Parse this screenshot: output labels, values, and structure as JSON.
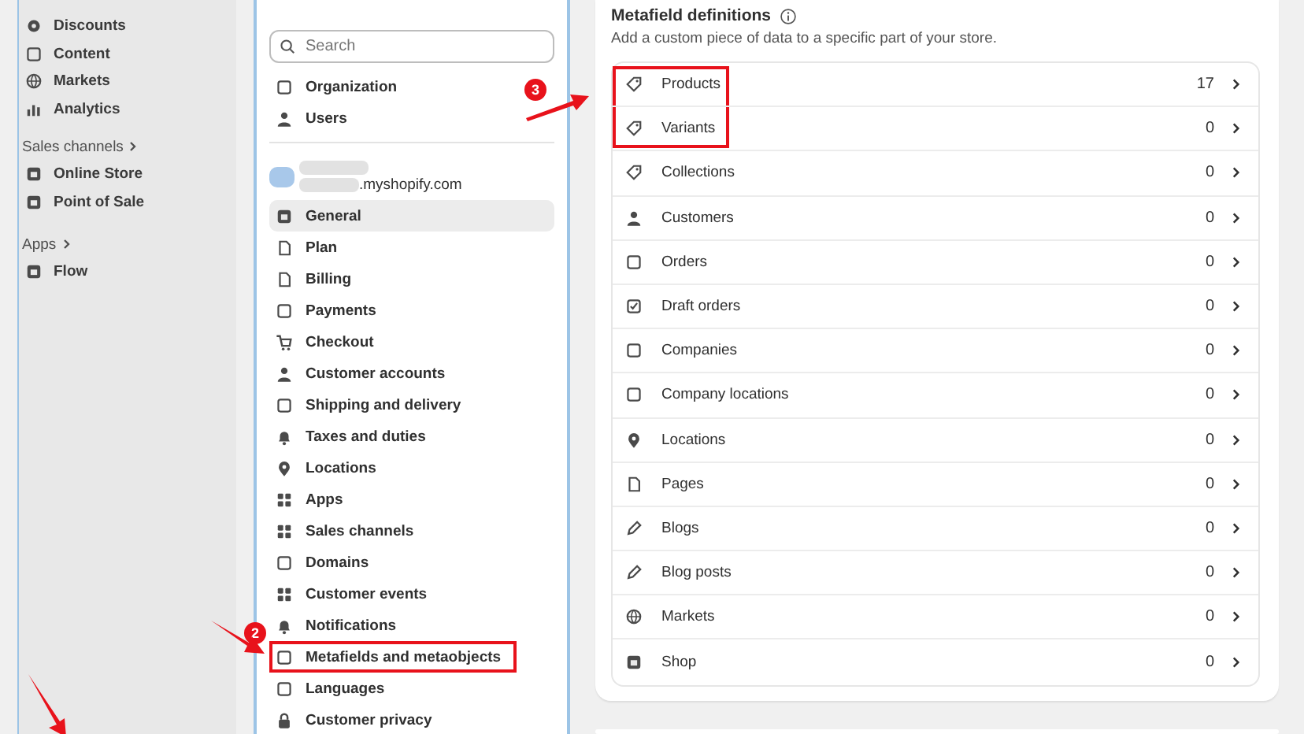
{
  "main_nav": {
    "items": [
      {
        "label": "Discounts"
      },
      {
        "label": "Content"
      },
      {
        "label": "Markets"
      },
      {
        "label": "Analytics"
      }
    ],
    "sections": [
      {
        "heading": "Sales channels",
        "items": [
          {
            "label": "Online Store"
          },
          {
            "label": "Point of Sale"
          }
        ]
      },
      {
        "heading": "Apps",
        "items": [
          {
            "label": "Flow"
          }
        ]
      }
    ]
  },
  "settings_nav": {
    "search": {
      "placeholder": "Search"
    },
    "top_items": [
      {
        "label": "Organization"
      },
      {
        "label": "Users"
      }
    ],
    "store": {
      "domain": ".myshopify.com"
    },
    "items": [
      {
        "label": "General",
        "selected": true,
        "highlighted": false
      },
      {
        "label": "Plan",
        "selected": false,
        "highlighted": false
      },
      {
        "label": "Billing",
        "selected": false,
        "highlighted": false
      },
      {
        "label": "Payments",
        "selected": false,
        "highlighted": false
      },
      {
        "label": "Checkout",
        "selected": false,
        "highlighted": false
      },
      {
        "label": "Customer accounts",
        "selected": false,
        "highlighted": false
      },
      {
        "label": "Shipping and delivery",
        "selected": false,
        "highlighted": false
      },
      {
        "label": "Taxes and duties",
        "selected": false,
        "highlighted": false
      },
      {
        "label": "Locations",
        "selected": false,
        "highlighted": false
      },
      {
        "label": "Apps",
        "selected": false,
        "highlighted": false
      },
      {
        "label": "Sales channels",
        "selected": false,
        "highlighted": false
      },
      {
        "label": "Domains",
        "selected": false,
        "highlighted": false
      },
      {
        "label": "Customer events",
        "selected": false,
        "highlighted": false
      },
      {
        "label": "Notifications",
        "selected": false,
        "highlighted": false
      },
      {
        "label": "Metafields and metaobjects",
        "selected": false,
        "highlighted": true
      },
      {
        "label": "Languages",
        "selected": false,
        "highlighted": false
      },
      {
        "label": "Customer privacy",
        "selected": false,
        "highlighted": false
      }
    ]
  },
  "metafields": {
    "title": "Metafield definitions",
    "description": "Add a custom piece of data to a specific part of your store.",
    "rows": [
      {
        "label": "Products",
        "count": "17",
        "highlighted": true
      },
      {
        "label": "Variants",
        "count": "0",
        "highlighted": true
      },
      {
        "label": "Collections",
        "count": "0",
        "highlighted": false
      },
      {
        "label": "Customers",
        "count": "0",
        "highlighted": false
      },
      {
        "label": "Orders",
        "count": "0",
        "highlighted": false
      },
      {
        "label": "Draft orders",
        "count": "0",
        "highlighted": false
      },
      {
        "label": "Companies",
        "count": "0",
        "highlighted": false
      },
      {
        "label": "Company locations",
        "count": "0",
        "highlighted": false
      },
      {
        "label": "Locations",
        "count": "0",
        "highlighted": false
      },
      {
        "label": "Pages",
        "count": "0",
        "highlighted": false
      },
      {
        "label": "Blogs",
        "count": "0",
        "highlighted": false
      },
      {
        "label": "Blog posts",
        "count": "0",
        "highlighted": false
      },
      {
        "label": "Markets",
        "count": "0",
        "highlighted": false
      },
      {
        "label": "Shop",
        "count": "0",
        "highlighted": false
      }
    ]
  },
  "callouts": [
    {
      "label": "3"
    },
    {
      "label": "2"
    }
  ]
}
